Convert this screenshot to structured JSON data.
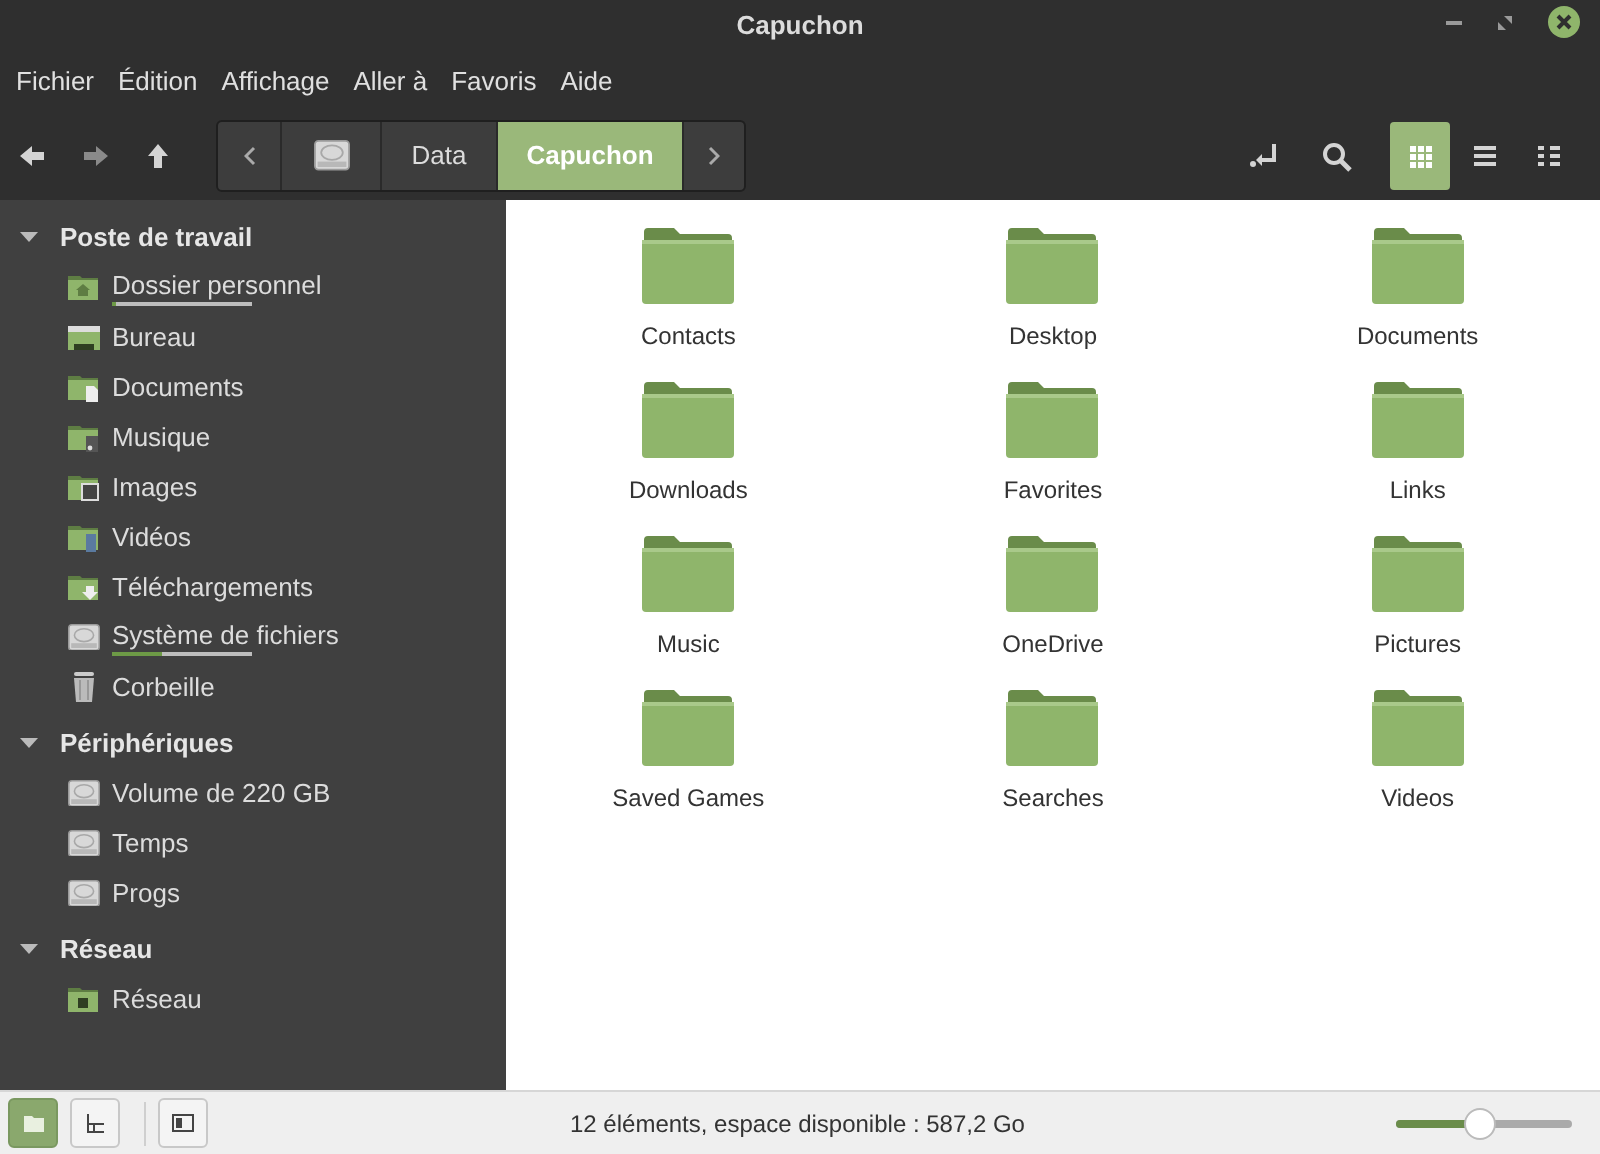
{
  "window": {
    "title": "Capuchon"
  },
  "menu": [
    "Fichier",
    "Édition",
    "Affichage",
    "Aller à",
    "Favoris",
    "Aide"
  ],
  "breadcrumbs": [
    {
      "kind": "drive",
      "selected": false
    },
    {
      "kind": "text",
      "label": "Data",
      "selected": false
    },
    {
      "kind": "text",
      "label": "Capuchon",
      "selected": true
    }
  ],
  "view_modes": [
    {
      "kind": "icons",
      "selected": true
    },
    {
      "kind": "list",
      "selected": false
    },
    {
      "kind": "compact",
      "selected": false
    }
  ],
  "sidebar": [
    {
      "label": "Poste de travail",
      "expanded": true,
      "items": [
        {
          "kind": "home",
          "label": "Dossier personnel",
          "level": 0.03
        },
        {
          "kind": "desktop",
          "label": "Bureau"
        },
        {
          "kind": "documents",
          "label": "Documents"
        },
        {
          "kind": "music",
          "label": "Musique"
        },
        {
          "kind": "pictures",
          "label": "Images"
        },
        {
          "kind": "videos",
          "label": "Vidéos"
        },
        {
          "kind": "downloads",
          "label": "Téléchargements"
        },
        {
          "kind": "drive",
          "label": "Système de fichiers",
          "level": 0.35
        },
        {
          "kind": "trash",
          "label": "Corbeille"
        }
      ]
    },
    {
      "label": "Périphériques",
      "expanded": true,
      "items": [
        {
          "kind": "drive",
          "label": "Volume de 220 GB"
        },
        {
          "kind": "drive",
          "label": "Temps"
        },
        {
          "kind": "drive",
          "label": "Progs"
        }
      ]
    },
    {
      "label": "Réseau",
      "expanded": true,
      "items": [
        {
          "kind": "network",
          "label": "Réseau"
        }
      ]
    }
  ],
  "files": [
    "Contacts",
    "Desktop",
    "Documents",
    "Downloads",
    "Favorites",
    "Links",
    "Music",
    "OneDrive",
    "Pictures",
    "Saved Games",
    "Searches",
    "Videos"
  ],
  "status_bar": {
    "text": "12 éléments, espace disponible : 587,2 Go",
    "sidebar_modes": [
      {
        "kind": "places",
        "selected": true
      },
      {
        "kind": "tree",
        "selected": false
      }
    ],
    "zoom": {
      "level": 0.48
    }
  }
}
